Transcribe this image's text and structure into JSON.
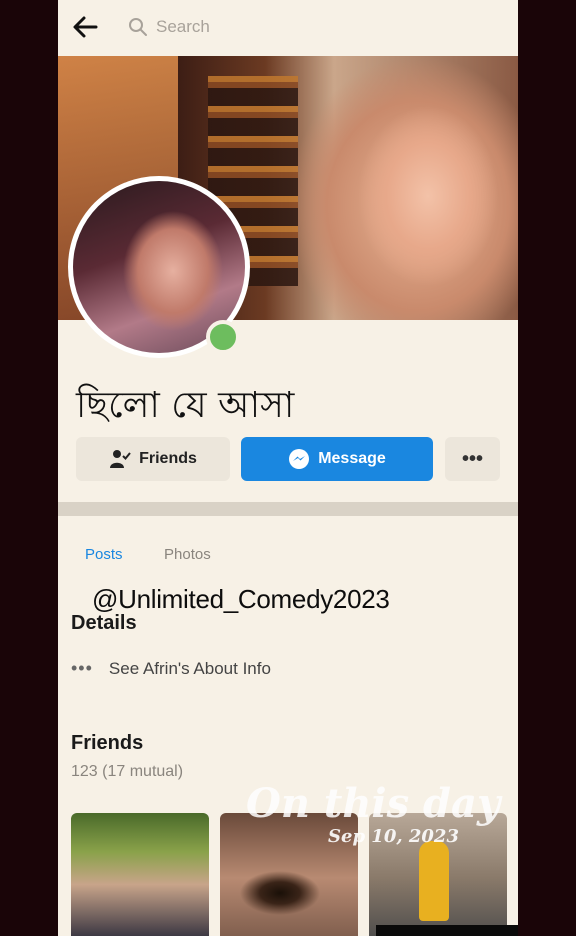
{
  "search": {
    "placeholder": "Search"
  },
  "profile": {
    "name": "ছিলো যে আসা"
  },
  "actions": {
    "friends_label": "Friends",
    "message_label": "Message",
    "more_label": "•••"
  },
  "tabs": [
    {
      "label": "Posts",
      "active": true
    },
    {
      "label": "Photos",
      "active": false
    }
  ],
  "watermark": "@Unlimited_Comedy2023",
  "details": {
    "heading": "Details",
    "about_dots": "•••",
    "about_link": "See Afrin's About Info"
  },
  "friends": {
    "heading": "Friends",
    "count": "123 (17 mutual)"
  },
  "overlay": {
    "title": "On this day",
    "date": "Sep 10, 2023"
  },
  "colors": {
    "accent": "#1a87e0",
    "online": "#6dbd5e",
    "background": "#f7f1e6"
  }
}
